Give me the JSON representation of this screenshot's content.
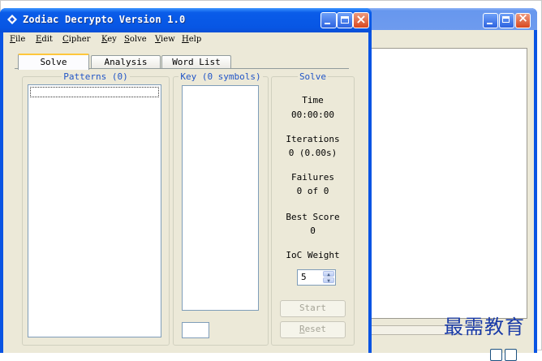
{
  "window": {
    "title": "Zodiac Decrypto Version 1.0",
    "minimize_label": "_",
    "maximize_label": "□",
    "close_label": "×"
  },
  "menu": [
    {
      "key": "F",
      "rest": "ile"
    },
    {
      "key": "E",
      "rest": "dit"
    },
    {
      "key": "C",
      "rest": "ipher"
    },
    {
      "key": "K",
      "rest": "ey"
    },
    {
      "key": "S",
      "rest": "olve"
    },
    {
      "key": "V",
      "rest": "iew"
    },
    {
      "key": "H",
      "rest": "elp"
    }
  ],
  "tabs": [
    {
      "label": "Solve",
      "active": true
    },
    {
      "label": "Analysis",
      "active": false
    },
    {
      "label": "Word List",
      "active": false
    }
  ],
  "patterns": {
    "label": "Patterns (0)"
  },
  "key": {
    "label": "Key (0 symbols)",
    "symbol_value": ""
  },
  "solve": {
    "label": "Solve",
    "time_label": "Time",
    "time_value": "00:00:00",
    "iterations_label": "Iterations",
    "iterations_value": "0 (0.00s)",
    "failures_label": "Failures",
    "failures_value": "0 of 0",
    "best_score_label": "Best Score",
    "best_score_value": "0",
    "ioc_label": "IoC Weight",
    "ioc_value": "5",
    "start_label": "Start",
    "reset_key": "R",
    "reset_rest": "eset"
  },
  "watermark": "最需教育",
  "colors": {
    "titlebar": "#0a54e3",
    "face": "#ece9d8",
    "group_label": "#2155c7",
    "tab_accent": "#ffc73c"
  }
}
